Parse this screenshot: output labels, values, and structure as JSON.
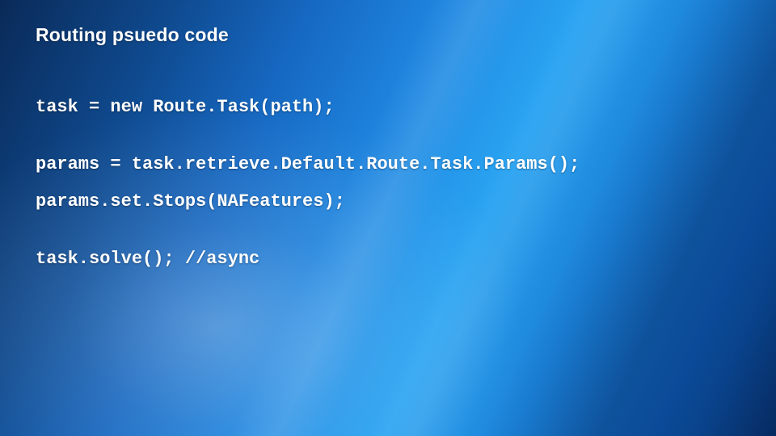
{
  "title": "Routing psuedo code",
  "code": {
    "line1": "task = new Route.Task(path);",
    "line2": "params = task.retrieve.Default.Route.Task.Params();",
    "line3": "params.set.Stops(NAFeatures);",
    "line4": "task.solve(); //async"
  }
}
